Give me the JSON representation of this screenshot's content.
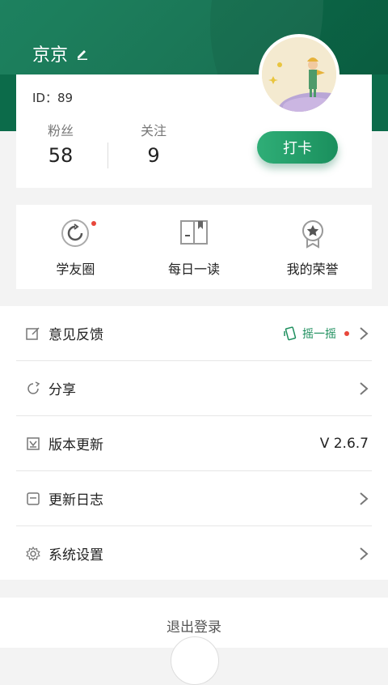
{
  "header": {
    "nickname": "京京",
    "id_text": "ID：89"
  },
  "stats": {
    "fans_label": "粉丝",
    "fans_value": "58",
    "follow_label": "关注",
    "follow_value": "9"
  },
  "checkin_label": "打卡",
  "quick": [
    {
      "label": "学友圈",
      "icon": "refresh-circle-icon"
    },
    {
      "label": "每日一读",
      "icon": "book-icon"
    },
    {
      "label": "我的荣誉",
      "icon": "badge-icon"
    }
  ],
  "menu": [
    {
      "label": "意见反馈",
      "icon": "edit-square-icon",
      "right_text": "摇一摇"
    },
    {
      "label": "分享",
      "icon": "share-icon"
    },
    {
      "label": "版本更新",
      "icon": "update-icon",
      "right_text": "V 2.6.7"
    },
    {
      "label": "更新日志",
      "icon": "log-icon"
    },
    {
      "label": "系统设置",
      "icon": "gear-icon"
    }
  ],
  "logout_label": "退出登录",
  "colors": {
    "brand_green": "#0f7a55",
    "accent_red": "#e8473b"
  }
}
